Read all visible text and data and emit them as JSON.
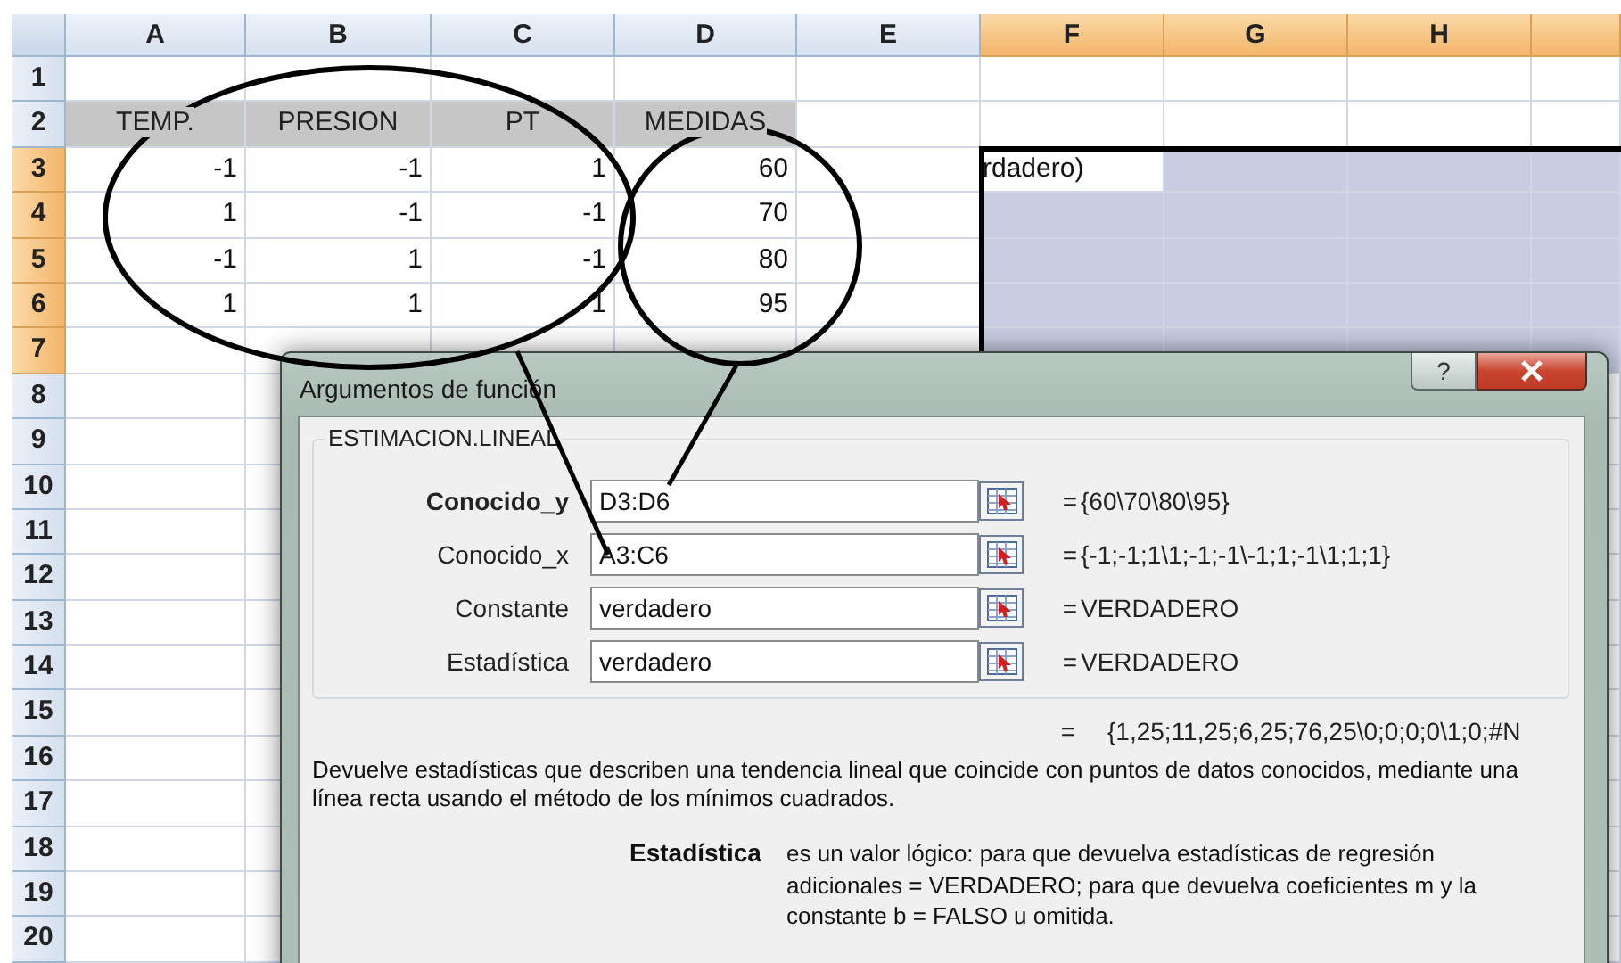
{
  "sheet": {
    "columns": [
      {
        "label": "A",
        "selected": false
      },
      {
        "label": "B",
        "selected": false
      },
      {
        "label": "C",
        "selected": false
      },
      {
        "label": "D",
        "selected": false
      },
      {
        "label": "E",
        "selected": false
      },
      {
        "label": "F",
        "selected": true
      },
      {
        "label": "G",
        "selected": true
      },
      {
        "label": "H",
        "selected": true
      },
      {
        "selected": true
      }
    ],
    "rows": [
      {
        "label": "1",
        "selected": false
      },
      {
        "label": "2",
        "selected": false,
        "cells": [
          {
            "kind": "header",
            "text": "TEMP.",
            "active": false
          },
          {
            "kind": "header",
            "text": "PRESION",
            "active": false
          },
          {
            "kind": "header",
            "text": "PT",
            "active": false
          },
          {
            "kind": "header",
            "text": "MEDIDAS",
            "active": false
          }
        ]
      },
      {
        "label": "3",
        "selected": true,
        "cells": [
          {
            "kind": "number",
            "text": "-1",
            "active": false
          },
          {
            "kind": "number",
            "text": "-1",
            "active": false
          },
          {
            "kind": "number",
            "text": "1",
            "active": false
          },
          {
            "kind": "number",
            "text": "60",
            "active": false
          },
          null,
          {
            "kind": "text",
            "text": "rdadero)",
            "active": true
          }
        ]
      },
      {
        "label": "4",
        "selected": true,
        "cells": [
          {
            "kind": "number",
            "text": "1",
            "active": false
          },
          {
            "kind": "number",
            "text": "-1",
            "active": false
          },
          {
            "kind": "number",
            "text": "-1",
            "active": false
          },
          {
            "kind": "number",
            "text": "70",
            "active": false
          }
        ]
      },
      {
        "label": "5",
        "selected": true,
        "cells": [
          {
            "kind": "number",
            "text": "-1",
            "active": false
          },
          {
            "kind": "number",
            "text": "1",
            "active": false
          },
          {
            "kind": "number",
            "text": "-1",
            "active": false
          },
          {
            "kind": "number",
            "text": "80",
            "active": false
          }
        ]
      },
      {
        "label": "6",
        "selected": true,
        "cells": [
          {
            "kind": "number",
            "text": "1",
            "active": false
          },
          {
            "kind": "number",
            "text": "1",
            "active": false
          },
          {
            "kind": "number",
            "text": "1",
            "active": false
          },
          {
            "kind": "number",
            "text": "95",
            "active": false
          }
        ]
      },
      {
        "label": "7",
        "selected": true
      },
      {
        "label": "8",
        "selected": false
      },
      {
        "label": "9",
        "selected": false
      },
      {
        "label": "10",
        "selected": false
      },
      {
        "label": "11",
        "selected": false
      },
      {
        "label": "12",
        "selected": false
      },
      {
        "label": "13",
        "selected": false
      },
      {
        "label": "14",
        "selected": false
      },
      {
        "label": "15",
        "selected": false
      },
      {
        "label": "16",
        "selected": false
      },
      {
        "label": "17",
        "selected": false
      },
      {
        "label": "18",
        "selected": false
      },
      {
        "label": "19",
        "selected": false
      },
      {
        "label": "20",
        "selected": false
      }
    ]
  },
  "dialog": {
    "title": "Argumentos de función",
    "help_button": "?",
    "function_name": "ESTIMACION.LINEAL",
    "arguments": [
      {
        "label": "Conocido_y",
        "bold": true,
        "value": "D3:D6",
        "sign": "=",
        "result": "{60\\70\\80\\95}"
      },
      {
        "label": "Conocido_x",
        "bold": false,
        "value": "A3:C6",
        "sign": "=",
        "result": "{-1;-1;1\\1;-1;-1\\-1;1;-1\\1;1;1}"
      },
      {
        "label": "Constante",
        "bold": false,
        "value": "verdadero",
        "sign": "=",
        "result": "VERDADERO"
      },
      {
        "label": "Estadística",
        "bold": false,
        "value": "verdadero",
        "sign": "=",
        "result": "VERDADERO"
      }
    ],
    "result_sign": "=",
    "result": "{1,25;11,25;6,25;76,25\\0;0;0;0\\1;0;#N",
    "description": "Devuelve estadísticas que describen una tendencia lineal que coincide con puntos de datos conocidos, mediante una línea recta usando el método de los mínimos cuadrados.",
    "argument_help": {
      "name": "Estadística",
      "text": "es un valor lógico: para que devuelva estadísticas de regresión adicionales = VERDADERO; para que devuelva coeficientes m y la constante b = FALSO u omitida."
    }
  }
}
